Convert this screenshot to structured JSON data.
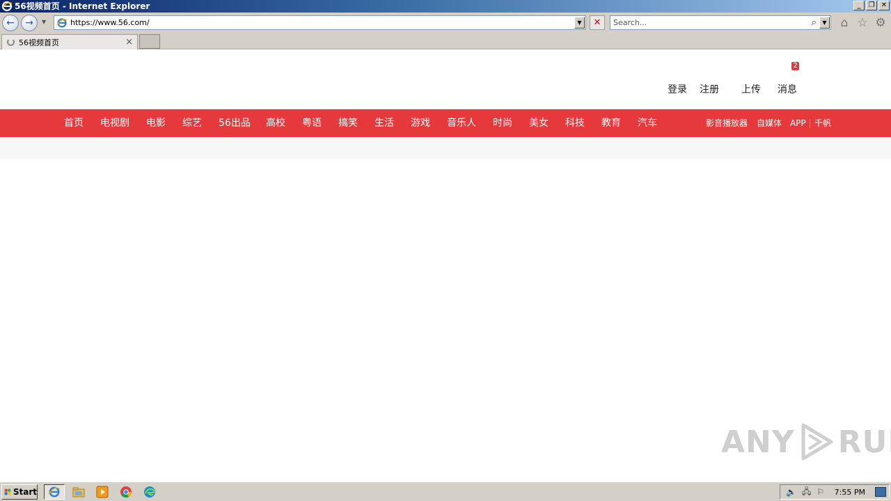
{
  "window": {
    "title": "56视频首页 - Internet Explorer",
    "minimize_label": "_",
    "restore_label": "❐",
    "close_label": "✕"
  },
  "navbar": {
    "url": "https://www.56.com/",
    "search_placeholder": "Search...",
    "back_glyph": "←",
    "forward_glyph": "→",
    "dropdown_glyph": "▼",
    "stop_glyph": "✕",
    "search_glyph": "⌕",
    "home_glyph": "⌂",
    "favorites_glyph": "☆",
    "tools_glyph": "⚙"
  },
  "tabs": [
    {
      "label": "56视频首页",
      "close": "×",
      "loading": true
    }
  ],
  "site": {
    "message_count": "2",
    "user_links": [
      "登录",
      "注册",
      "上传",
      "消息"
    ],
    "nav_items": [
      "首页",
      "电视剧",
      "电影",
      "综艺",
      "56出品",
      "高校",
      "粤语",
      "搞笑",
      "生活",
      "游戏",
      "音乐人",
      "时尚",
      "美女",
      "科技",
      "教育",
      "汽车"
    ],
    "right_links": [
      "影音播放器",
      "自媒体",
      "APP",
      "千帆"
    ],
    "accent_color": "#e5393b"
  },
  "watermark": {
    "text_left": "ANY",
    "text_right": "RUN"
  },
  "taskbar": {
    "start_label": "Start",
    "clock": "7:55 PM",
    "apps": [
      "internet-explorer",
      "file-explorer",
      "media-player",
      "chrome",
      "edge"
    ]
  }
}
